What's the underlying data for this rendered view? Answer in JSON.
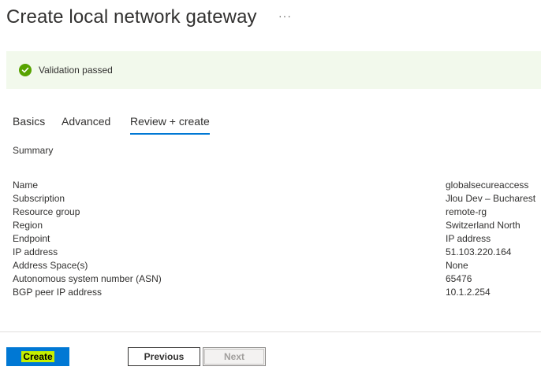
{
  "page": {
    "title": "Create local network gateway",
    "more_label": "···"
  },
  "banner": {
    "message": "Validation passed",
    "icon": "check-circle-icon",
    "color": "#57a300",
    "background": "#f2f9ec"
  },
  "tabs": [
    {
      "label": "Basics",
      "active": false
    },
    {
      "label": "Advanced",
      "active": false
    },
    {
      "label": "Review + create",
      "active": true
    }
  ],
  "summary_heading": "Summary",
  "details": [
    {
      "key": "Name",
      "value": "globalsecureaccess"
    },
    {
      "key": "Subscription",
      "value": "Jlou Dev – Bucharest"
    },
    {
      "key": "Resource group",
      "value": "remote-rg"
    },
    {
      "key": "Region",
      "value": "Switzerland North"
    },
    {
      "key": "Endpoint",
      "value": "IP address"
    },
    {
      "key": "IP address",
      "value": "51.103.220.164"
    },
    {
      "key": "Address Space(s)",
      "value": "None"
    },
    {
      "key": "Autonomous system number (ASN)",
      "value": "65476"
    },
    {
      "key": "BGP peer IP address",
      "value": "10.1.2.254"
    }
  ],
  "footer": {
    "create_label": "Create",
    "previous_label": "Previous",
    "next_label": "Next",
    "accent": "#0078d4",
    "highlight": "#c6f000"
  }
}
